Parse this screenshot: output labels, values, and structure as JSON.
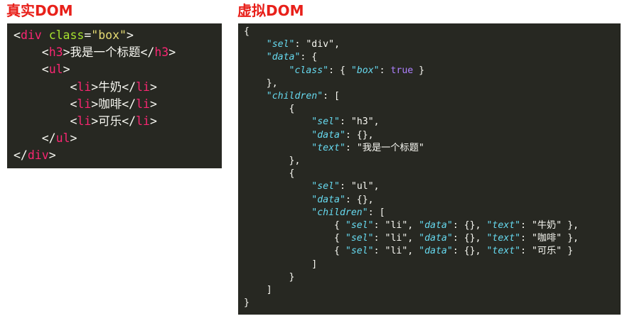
{
  "headings": {
    "real": "真实DOM",
    "virtual": "虚拟DOM"
  },
  "real_dom": {
    "div_tag": "div",
    "class_attr": "class",
    "class_value": "\"box\"",
    "h3_tag": "h3",
    "h3_text": "我是一个标题",
    "ul_tag": "ul",
    "li_tag": "li",
    "items": [
      "牛奶",
      "咖啡",
      "可乐"
    ]
  },
  "virtual_dom": {
    "k_sel": "\"sel\"",
    "k_data": "\"data\"",
    "k_class": "\"class\"",
    "k_box": "\"box\"",
    "k_children": "\"children\"",
    "k_text": "\"text\"",
    "v_div": "\"div\"",
    "v_true": "true",
    "v_h3": "\"h3\"",
    "v_h3_text": "\"我是一个标题\"",
    "v_ul": "\"ul\"",
    "v_li": "\"li\"",
    "li_texts": [
      "\"牛奶\"",
      "\"咖啡\"",
      "\"可乐\""
    ]
  }
}
